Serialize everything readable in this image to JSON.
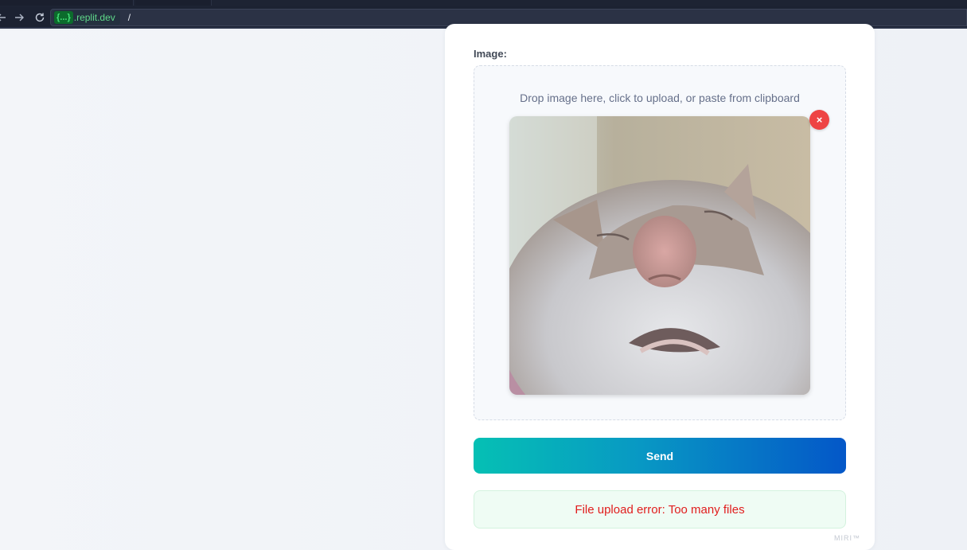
{
  "browser": {
    "url_pill": "{...}",
    "url_host": ".replit.dev",
    "url_path": "/"
  },
  "form": {
    "image_label": "Image:",
    "drop_hint": "Drop image here, click to upload, or paste from clipboard",
    "remove_label": "×",
    "send_label": "Send",
    "error_message": "File upload error: Too many files"
  },
  "brand": {
    "mark": "MIRI™"
  },
  "colors": {
    "error": "#e11d1d",
    "remove": "#ee4444",
    "send_gradient_start": "#05c0b4",
    "send_gradient_end": "#0457c8"
  },
  "icons": {
    "back": "arrow-left-icon",
    "forward": "arrow-right-icon",
    "reload": "reload-icon",
    "remove": "close-icon"
  }
}
